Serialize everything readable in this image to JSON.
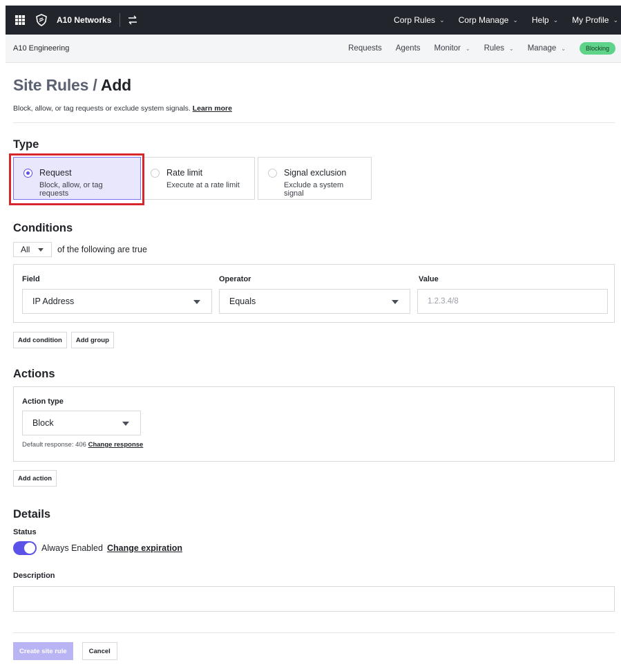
{
  "topbar": {
    "brand": "A10 Networks",
    "nav": [
      "Corp Rules",
      "Corp Manage",
      "Help",
      "My Profile"
    ]
  },
  "subbar": {
    "org": "A10 Engineering",
    "links": [
      "Requests",
      "Agents",
      "Monitor",
      "Rules",
      "Manage"
    ],
    "badge": "Blocking"
  },
  "page": {
    "title_prefix": "Site Rules / ",
    "title_main": "Add",
    "subtitle": "Block, allow, or tag requests or exclude system signals.",
    "learn_more": "Learn more"
  },
  "type": {
    "heading": "Type",
    "options": [
      {
        "title": "Request",
        "desc": "Block, allow, or tag requests",
        "selected": true
      },
      {
        "title": "Rate limit",
        "desc": "Execute at a rate limit",
        "selected": false
      },
      {
        "title": "Signal exclusion",
        "desc": "Exclude a system signal",
        "selected": false
      }
    ]
  },
  "conditions": {
    "heading": "Conditions",
    "match_select": "All",
    "match_text": "of the following are true",
    "field_label": "Field",
    "operator_label": "Operator",
    "value_label": "Value",
    "field_value": "IP Address",
    "operator_value": "Equals",
    "value_placeholder": "1.2.3.4/8",
    "add_condition": "Add condition",
    "add_group": "Add group"
  },
  "actions": {
    "heading": "Actions",
    "action_type_label": "Action type",
    "action_type_value": "Block",
    "default_response": "Default response: 406",
    "change_response": "Change response",
    "add_action": "Add action"
  },
  "details": {
    "heading": "Details",
    "status_label": "Status",
    "status_text": "Always Enabled",
    "change_expiration": "Change expiration",
    "description_label": "Description"
  },
  "footer": {
    "create": "Create site rule",
    "cancel": "Cancel"
  },
  "colors": {
    "accent": "#5b52e8",
    "highlight": "#d7262b",
    "badge": "#5fd38a"
  }
}
